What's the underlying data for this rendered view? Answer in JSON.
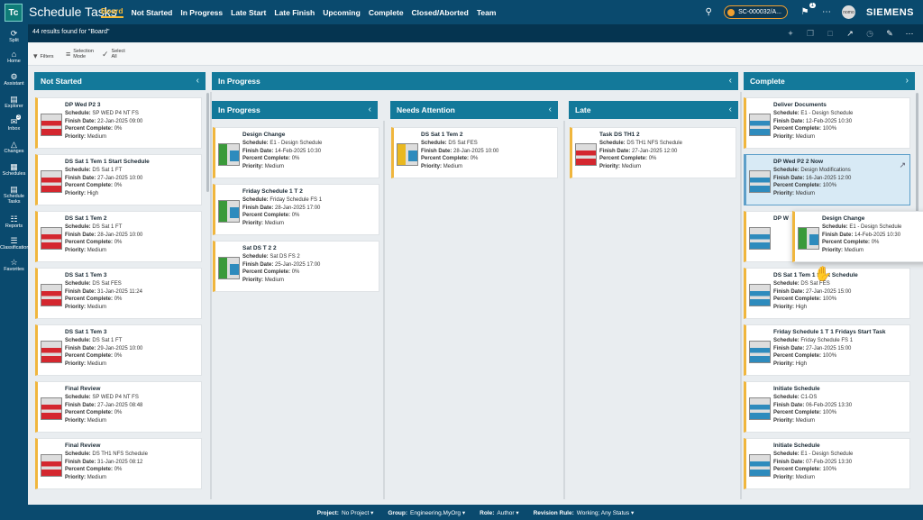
{
  "header": {
    "logo": "Tc",
    "title": "Schedule Tasks",
    "tabs": [
      "Board",
      "Not Started",
      "In Progress",
      "Late Start",
      "Late Finish",
      "Upcoming",
      "Complete",
      "Closed/Aborted",
      "Team"
    ],
    "active_tab": "Board",
    "ticket": "SC-000032/A...",
    "notification_count": "1",
    "avatar_text": "nomo",
    "brand": "SIEMENS"
  },
  "rail": [
    {
      "label": "Split",
      "icon": "split-icon"
    },
    {
      "label": "Home",
      "icon": "home-icon"
    },
    {
      "label": "Assistant",
      "icon": "assistant-icon"
    },
    {
      "label": "Explorer",
      "icon": "explorer-icon"
    },
    {
      "label": "Inbox",
      "icon": "inbox-icon",
      "badge": "3"
    },
    {
      "label": "Changes",
      "icon": "changes-icon"
    },
    {
      "label": "Schedules",
      "icon": "schedules-icon"
    },
    {
      "label": "Schedule Tasks",
      "icon": "schedule-tasks-icon"
    },
    {
      "label": "Reports",
      "icon": "reports-icon"
    },
    {
      "label": "Classification",
      "icon": "classification-icon"
    },
    {
      "label": "Favorites",
      "icon": "favorites-icon"
    }
  ],
  "results": "44 results found for \"Board\"",
  "toolbar": {
    "filters": "Filters",
    "selection_mode": [
      "Selection",
      "Mode"
    ],
    "select_all": [
      "Select",
      "All"
    ]
  },
  "lanes": {
    "not_started": {
      "title": "Not Started",
      "chev": "‹"
    },
    "in_progress": {
      "title": "In Progress",
      "chev": "‹"
    },
    "complete": {
      "title": "Complete",
      "chev": "›"
    },
    "sub_in_progress": {
      "title": "In Progress",
      "chev": "‹"
    },
    "needs_attention": {
      "title": "Needs Attention",
      "chev": "‹"
    },
    "late": {
      "title": "Late",
      "chev": "‹"
    }
  },
  "labels": {
    "schedule": "Schedule:",
    "finish": "Finish Date:",
    "percent": "Percent Complete:",
    "priority": "Priority:"
  },
  "cards": {
    "not_started": [
      {
        "title": "DP Wed P2 3",
        "schedule": "SP WED P4 NT FS",
        "finish": "22-Jan-2025 09:00",
        "percent": "0%",
        "priority": "Medium",
        "thumb": "red"
      },
      {
        "title": "DS Sat 1 Tem 1 Start Schedule",
        "schedule": "DS Sat 1 FT",
        "finish": "27-Jan-2025 10:00",
        "percent": "0%",
        "priority": "High",
        "thumb": "red"
      },
      {
        "title": "DS Sat 1 Tem 2",
        "schedule": "DS Sat 1 FT",
        "finish": "28-Jan-2025 10:00",
        "percent": "0%",
        "priority": "Medium",
        "thumb": "red"
      },
      {
        "title": "DS Sat 1 Tem 3",
        "schedule": "DS Sat FES",
        "finish": "31-Jan-2025 11:24",
        "percent": "0%",
        "priority": "Medium",
        "thumb": "red"
      },
      {
        "title": "DS Sat 1 Tem 3",
        "schedule": "DS Sat 1 FT",
        "finish": "29-Jan-2025 10:00",
        "percent": "0%",
        "priority": "Medium",
        "thumb": "red"
      },
      {
        "title": "Final Review",
        "schedule": "SP WED P4 NT FS",
        "finish": "27-Jan-2025 08:48",
        "percent": "0%",
        "priority": "Medium",
        "thumb": "red"
      },
      {
        "title": "Final Review",
        "schedule": "DS TH1 NFS Schedule",
        "finish": "31-Jan-2025 08:12",
        "percent": "0%",
        "priority": "Medium",
        "thumb": "red"
      }
    ],
    "in_progress": [
      {
        "title": "Design Change",
        "schedule": "E1 - Design Schedule",
        "finish": "14-Feb-2025 10:30",
        "percent": "0%",
        "priority": "Medium",
        "thumb": "green"
      },
      {
        "title": "Friday Schedule 1 T 2",
        "schedule": "Friday Schedule FS 1",
        "finish": "28-Jan-2025 17:00",
        "percent": "0%",
        "priority": "Medium",
        "thumb": "green"
      },
      {
        "title": "Sat DS T 2 2",
        "schedule": "Sat DS FS 2",
        "finish": "25-Jan-2025 17:00",
        "percent": "0%",
        "priority": "Medium",
        "thumb": "green"
      }
    ],
    "needs_attention": [
      {
        "title": "DS Sat 1 Tem 2",
        "schedule": "DS Sat FES",
        "finish": "28-Jan-2025 10:00",
        "percent": "0%",
        "priority": "Medium",
        "thumb": "yellow"
      }
    ],
    "late": [
      {
        "title": "Task DS TH1 2",
        "schedule": "DS TH1 NFS Schedule",
        "finish": "27-Jan-2025 12:00",
        "percent": "0%",
        "priority": "Medium",
        "thumb": "red"
      }
    ],
    "complete": [
      {
        "title": "Deliver Documents",
        "schedule": "E1 - Design Schedule",
        "finish": "12-Feb-2025 10:30",
        "percent": "100%",
        "priority": "Medium",
        "thumb": "blue"
      },
      {
        "title": "DP Wed P2 2 Now",
        "schedule": "Design Modifications",
        "finish": "16-Jan-2025 12:00",
        "percent": "100%",
        "priority": "Medium",
        "thumb": "blue"
      },
      {
        "title": "DP W",
        "schedule": "",
        "finish": "",
        "percent": "",
        "priority": "",
        "thumb": "blue"
      },
      {
        "title": "DS Sat 1 Tem 1 Start Schedule",
        "schedule": "DS Sat FES",
        "finish": "27-Jan-2025 15:00",
        "percent": "100%",
        "priority": "High",
        "thumb": "blue"
      },
      {
        "title": "Friday Schedule 1 T 1 Fridays Start Task",
        "schedule": "Friday Schedule FS 1",
        "finish": "27-Jan-2025 15:00",
        "percent": "100%",
        "priority": "High",
        "thumb": "blue"
      },
      {
        "title": "Initiate Schedule",
        "schedule": "C1-DS",
        "finish": "06-Feb-2025 13:30",
        "percent": "100%",
        "priority": "Medium",
        "thumb": "blue"
      },
      {
        "title": "Initiate Schedule",
        "schedule": "E1 - Design Schedule",
        "finish": "07-Feb-2025 13:30",
        "percent": "100%",
        "priority": "Medium",
        "thumb": "blue"
      }
    ],
    "dragging": {
      "title": "Design Change",
      "schedule": "E1 - Design Schedule",
      "finish": "14-Feb-2025 10:30",
      "percent": "0%",
      "priority": "Medium",
      "thumb": "green"
    }
  },
  "status": [
    {
      "label": "Project:",
      "value": "No Project"
    },
    {
      "label": "Group:",
      "value": "Engineering.MyOrg"
    },
    {
      "label": "Role:",
      "value": "Author"
    },
    {
      "label": "Revision Rule:",
      "value": "Working; Any Status"
    }
  ],
  "colors": {
    "header": "#0a4a6e",
    "lane_header": "#13799a",
    "accent": "#f5b935"
  }
}
